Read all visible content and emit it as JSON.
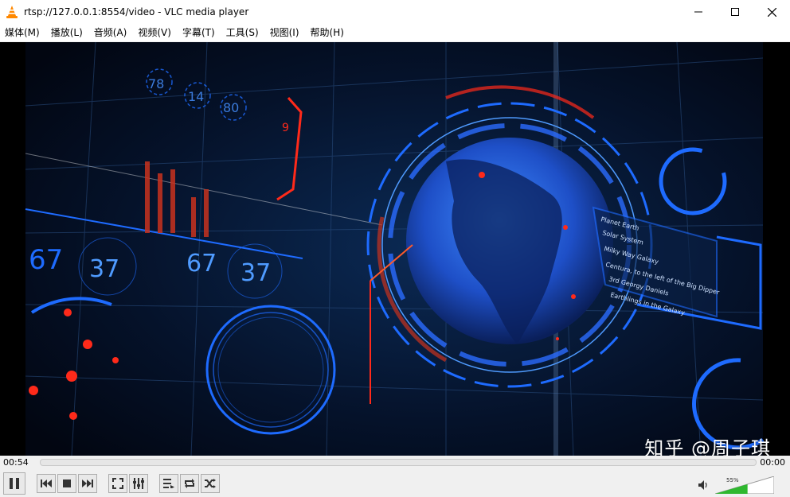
{
  "window": {
    "title": "rtsp://127.0.0.1:8554/video - VLC media player"
  },
  "menu": {
    "items": [
      "媒体(M)",
      "播放(L)",
      "音频(A)",
      "视频(V)",
      "字幕(T)",
      "工具(S)",
      "视图(I)",
      "帮助(H)"
    ]
  },
  "video": {
    "hud_numbers": [
      "67",
      "37",
      "67",
      "37"
    ],
    "hud_small_numbers": [
      "78",
      "14",
      "80"
    ],
    "hud_panel_lines": [
      "Planet Earth",
      "Solar System",
      "Milky Way Galaxy",
      "Centura, to the left of the Big Dipper",
      "3rd Georgy Daniels",
      "Earthlings in the Galaxy"
    ],
    "watermark": "知乎 @周子琪"
  },
  "playback": {
    "elapsed": "00:54",
    "total": "00:00",
    "progress_fraction": 0.0
  },
  "volume": {
    "level_label": "55%",
    "level_fraction": 0.55
  },
  "colors": {
    "accent_blue": "#1e6bff",
    "hud_red": "#ff2a1a",
    "volume_green": "#2fb82f"
  },
  "icons": {
    "app": "vlc-cone-icon",
    "minimize": "minimize-icon",
    "maximize": "maximize-icon",
    "close": "close-icon",
    "pause": "pause-icon",
    "prev": "previous-icon",
    "stop": "stop-icon",
    "next": "next-icon",
    "fullscreen": "fullscreen-icon",
    "extended": "extended-settings-icon",
    "playlist": "playlist-icon",
    "loop": "loop-icon",
    "shuffle": "shuffle-icon",
    "volume": "speaker-icon"
  }
}
